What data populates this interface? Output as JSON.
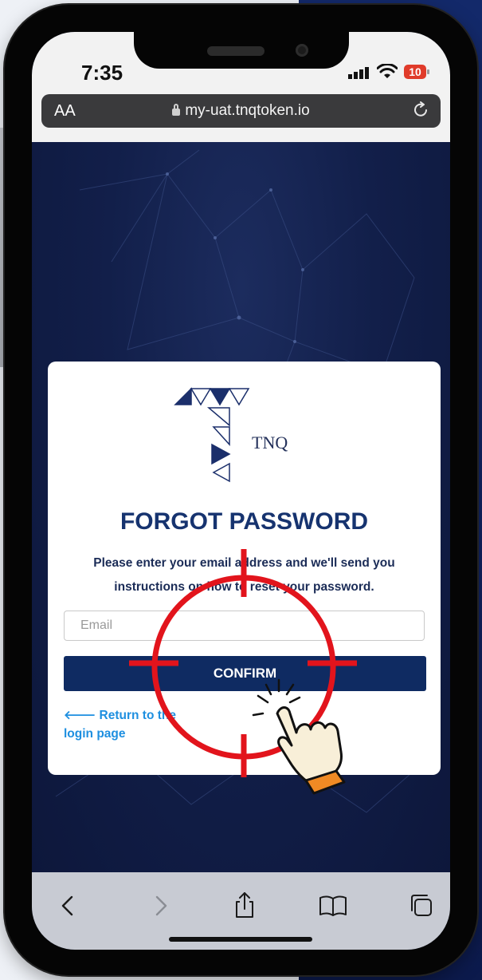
{
  "status_bar": {
    "time": "7:35",
    "battery": "10"
  },
  "url_bar": {
    "text_size_label": "AA",
    "url": "my-uat.tnqtoken.io"
  },
  "card": {
    "logo_text": "TNQ",
    "title": "FORGOT PASSWORD",
    "instructions": "Please enter your email address and we'll send you instructions on how to reset your password.",
    "email_placeholder": "Email",
    "email_value": "",
    "confirm_label": "CONFIRM",
    "return_link_label": "Return to the login page"
  },
  "colors": {
    "navy_background": "#121f4a",
    "button_navy": "#0f2b62",
    "heading_blue": "#16336f",
    "link_blue": "#1e8fe0",
    "crosshair_red": "#e2141c",
    "battery_red": "#e03b2a"
  },
  "icons": {
    "signal": "signal-icon",
    "wifi": "wifi-icon",
    "battery": "battery-icon",
    "lock": "lock-icon",
    "reload": "reload-icon",
    "back": "chevron-left-icon",
    "forward": "chevron-right-icon",
    "share": "share-icon",
    "bookmarks": "book-icon",
    "tabs": "tabs-icon",
    "cursor": "pointing-hand-icon"
  }
}
